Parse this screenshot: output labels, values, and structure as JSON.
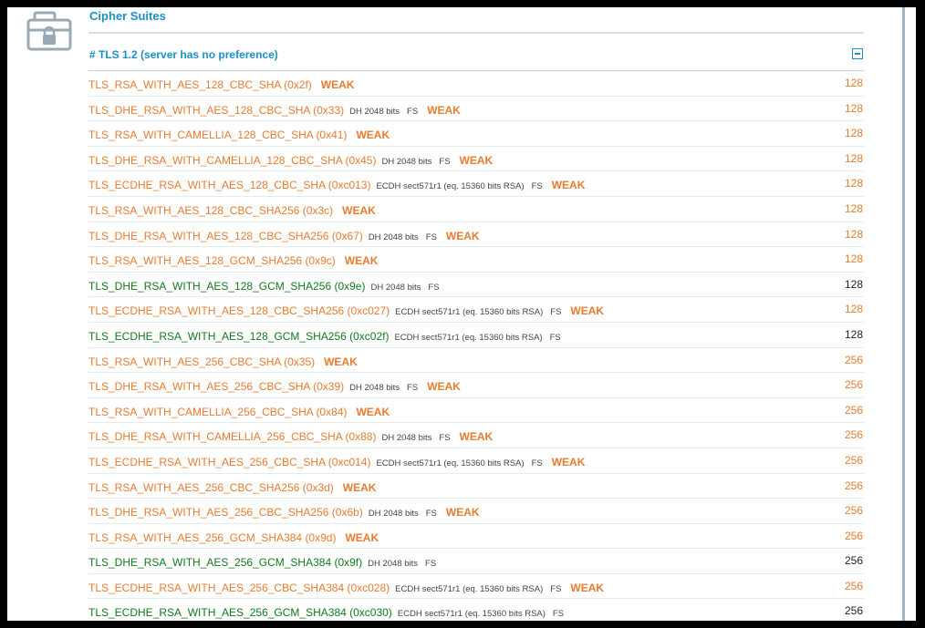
{
  "section": {
    "title": "Cipher Suites",
    "group_title": "# TLS 1.2 (server has no preference)",
    "icon": "toolbox-lock-icon"
  },
  "colors": {
    "weak": "#e77c31",
    "strong": "#117a1e",
    "heading": "#1a8fc9"
  },
  "suites": [
    {
      "name": "TLS_RSA_WITH_AES_128_CBC_SHA (0x2f)",
      "kx": "",
      "fs": "",
      "flag": "WEAK",
      "bits": "128",
      "status": "weak"
    },
    {
      "name": "TLS_DHE_RSA_WITH_AES_128_CBC_SHA (0x33)",
      "kx": "DH 2048 bits",
      "fs": "FS",
      "flag": "WEAK",
      "bits": "128",
      "status": "weak"
    },
    {
      "name": "TLS_RSA_WITH_CAMELLIA_128_CBC_SHA (0x41)",
      "kx": "",
      "fs": "",
      "flag": "WEAK",
      "bits": "128",
      "status": "weak"
    },
    {
      "name": "TLS_DHE_RSA_WITH_CAMELLIA_128_CBC_SHA (0x45)",
      "kx": "DH 2048 bits",
      "fs": "FS",
      "flag": "WEAK",
      "bits": "128",
      "status": "weak"
    },
    {
      "name": "TLS_ECDHE_RSA_WITH_AES_128_CBC_SHA (0xc013)",
      "kx": "ECDH sect571r1 (eq. 15360 bits RSA)",
      "fs": "FS",
      "flag": "WEAK",
      "bits": "128",
      "status": "weak"
    },
    {
      "name": "TLS_RSA_WITH_AES_128_CBC_SHA256 (0x3c)",
      "kx": "",
      "fs": "",
      "flag": "WEAK",
      "bits": "128",
      "status": "weak"
    },
    {
      "name": "TLS_DHE_RSA_WITH_AES_128_CBC_SHA256 (0x67)",
      "kx": "DH 2048 bits",
      "fs": "FS",
      "flag": "WEAK",
      "bits": "128",
      "status": "weak"
    },
    {
      "name": "TLS_RSA_WITH_AES_128_GCM_SHA256 (0x9c)",
      "kx": "",
      "fs": "",
      "flag": "WEAK",
      "bits": "128",
      "status": "weak"
    },
    {
      "name": "TLS_DHE_RSA_WITH_AES_128_GCM_SHA256 (0x9e)",
      "kx": "DH 2048 bits",
      "fs": "FS",
      "flag": "",
      "bits": "128",
      "status": "strong"
    },
    {
      "name": "TLS_ECDHE_RSA_WITH_AES_128_CBC_SHA256 (0xc027)",
      "kx": "ECDH sect571r1 (eq. 15360 bits RSA)",
      "fs": "FS",
      "flag": "WEAK",
      "bits": "128",
      "status": "weak"
    },
    {
      "name": "TLS_ECDHE_RSA_WITH_AES_128_GCM_SHA256 (0xc02f)",
      "kx": "ECDH sect571r1 (eq. 15360 bits RSA)",
      "fs": "FS",
      "flag": "",
      "bits": "128",
      "status": "strong"
    },
    {
      "name": "TLS_RSA_WITH_AES_256_CBC_SHA (0x35)",
      "kx": "",
      "fs": "",
      "flag": "WEAK",
      "bits": "256",
      "status": "weak"
    },
    {
      "name": "TLS_DHE_RSA_WITH_AES_256_CBC_SHA (0x39)",
      "kx": "DH 2048 bits",
      "fs": "FS",
      "flag": "WEAK",
      "bits": "256",
      "status": "weak"
    },
    {
      "name": "TLS_RSA_WITH_CAMELLIA_256_CBC_SHA (0x84)",
      "kx": "",
      "fs": "",
      "flag": "WEAK",
      "bits": "256",
      "status": "weak"
    },
    {
      "name": "TLS_DHE_RSA_WITH_CAMELLIA_256_CBC_SHA (0x88)",
      "kx": "DH 2048 bits",
      "fs": "FS",
      "flag": "WEAK",
      "bits": "256",
      "status": "weak"
    },
    {
      "name": "TLS_ECDHE_RSA_WITH_AES_256_CBC_SHA (0xc014)",
      "kx": "ECDH sect571r1 (eq. 15360 bits RSA)",
      "fs": "FS",
      "flag": "WEAK",
      "bits": "256",
      "status": "weak"
    },
    {
      "name": "TLS_RSA_WITH_AES_256_CBC_SHA256 (0x3d)",
      "kx": "",
      "fs": "",
      "flag": "WEAK",
      "bits": "256",
      "status": "weak"
    },
    {
      "name": "TLS_DHE_RSA_WITH_AES_256_CBC_SHA256 (0x6b)",
      "kx": "DH 2048 bits",
      "fs": "FS",
      "flag": "WEAK",
      "bits": "256",
      "status": "weak"
    },
    {
      "name": "TLS_RSA_WITH_AES_256_GCM_SHA384 (0x9d)",
      "kx": "",
      "fs": "",
      "flag": "WEAK",
      "bits": "256",
      "status": "weak"
    },
    {
      "name": "TLS_DHE_RSA_WITH_AES_256_GCM_SHA384 (0x9f)",
      "kx": "DH 2048 bits",
      "fs": "FS",
      "flag": "",
      "bits": "256",
      "status": "strong"
    },
    {
      "name": "TLS_ECDHE_RSA_WITH_AES_256_CBC_SHA384 (0xc028)",
      "kx": "ECDH sect571r1 (eq. 15360 bits RSA)",
      "fs": "FS",
      "flag": "WEAK",
      "bits": "256",
      "status": "weak"
    },
    {
      "name": "TLS_ECDHE_RSA_WITH_AES_256_GCM_SHA384 (0xc030)",
      "kx": "ECDH sect571r1 (eq. 15360 bits RSA)",
      "fs": "FS",
      "flag": "",
      "bits": "256",
      "status": "strong"
    }
  ]
}
